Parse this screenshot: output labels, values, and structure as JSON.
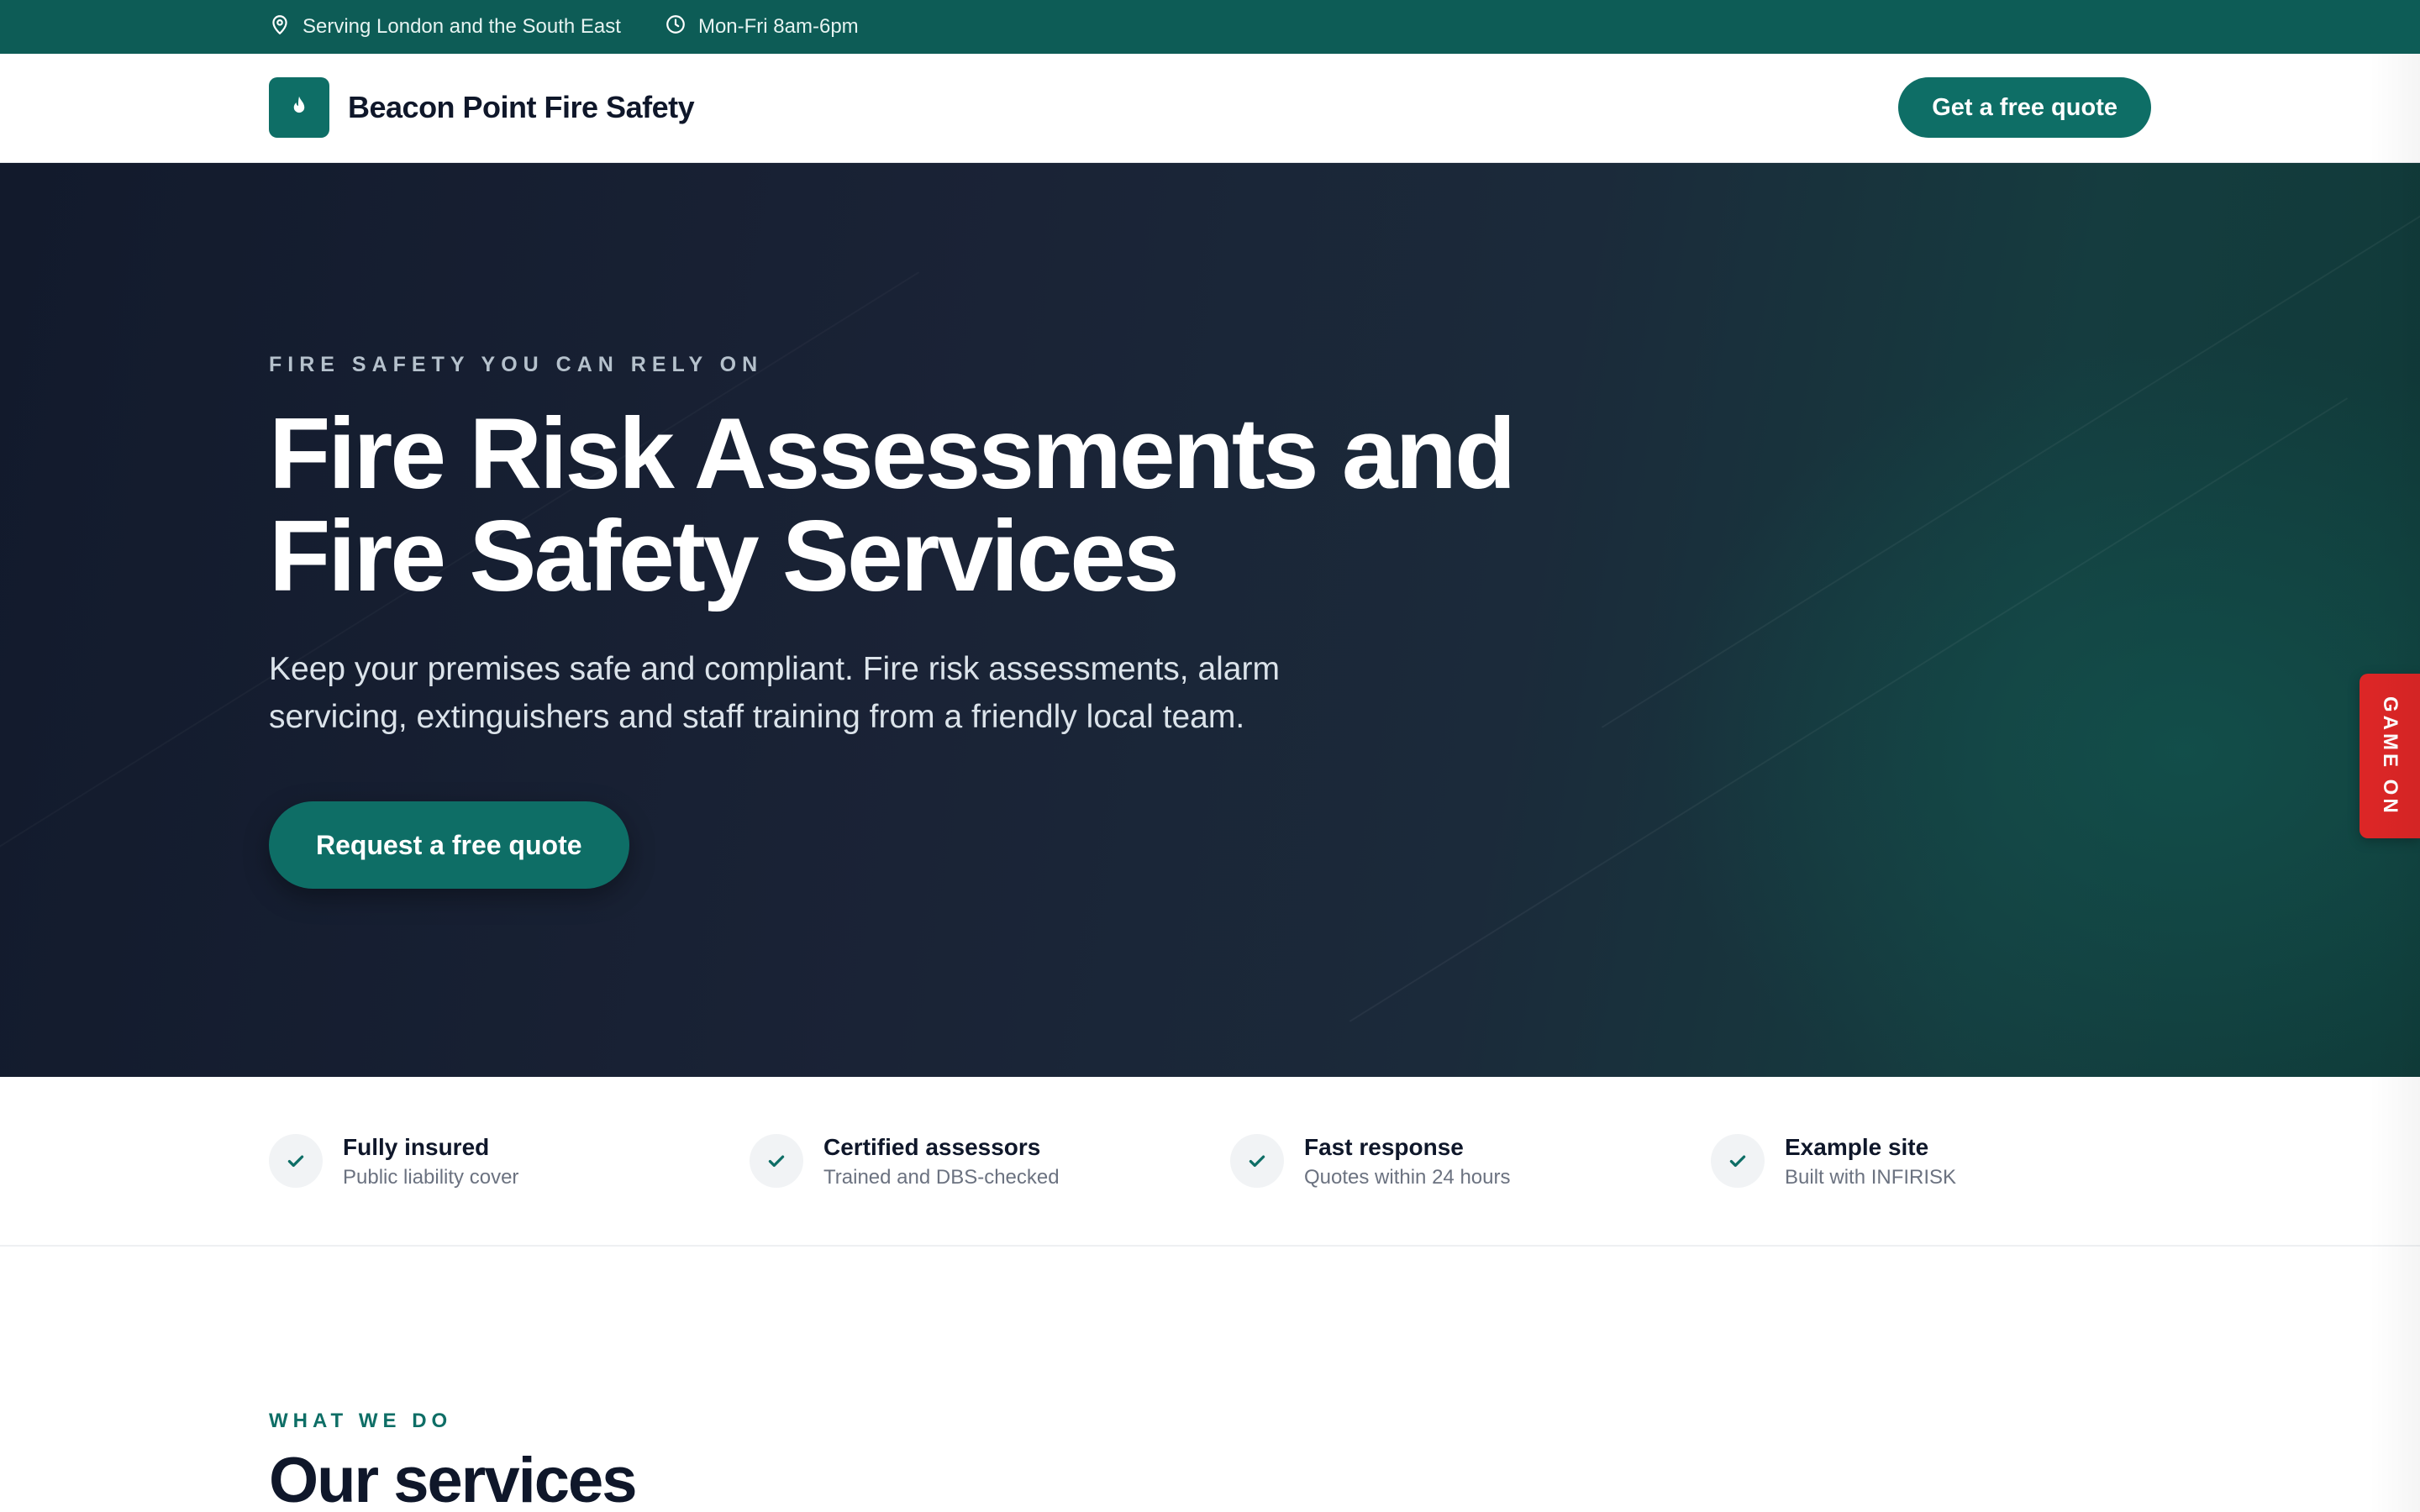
{
  "topbar": {
    "location": "Serving London and the South East",
    "hours": "Mon-Fri 8am-6pm"
  },
  "header": {
    "brand_name": "Beacon Point Fire Safety",
    "cta_label": "Get a free quote"
  },
  "hero": {
    "eyebrow": "FIRE SAFETY YOU CAN RELY ON",
    "title_line1": "Fire Risk Assessments and",
    "title_line2": "Fire Safety Services",
    "subtitle_line1": "Keep your premises safe and compliant. Fire risk assessments, alarm",
    "subtitle_line2": "servicing, extinguishers and staff training from a friendly local team.",
    "cta_label": "Request a free quote"
  },
  "side_tab": {
    "label": "GAME ON"
  },
  "features": [
    {
      "title": "Fully insured",
      "subtitle": "Public liability cover"
    },
    {
      "title": "Certified assessors",
      "subtitle": "Trained and DBS-checked"
    },
    {
      "title": "Fast response",
      "subtitle": "Quotes within 24 hours"
    },
    {
      "title": "Example site",
      "subtitle": "Built with INFIRISK"
    }
  ],
  "services": {
    "eyebrow": "WHAT WE DO",
    "title": "Our services"
  },
  "colors": {
    "brand_teal": "#0e6e66",
    "topbar_bg": "#0d5c56",
    "hero_dark": "#121a2c",
    "side_tab_red": "#dc2626"
  },
  "icons": {
    "location": "map-pin-icon",
    "hours": "clock-icon",
    "logo": "flame-icon",
    "feature": "check-icon"
  }
}
